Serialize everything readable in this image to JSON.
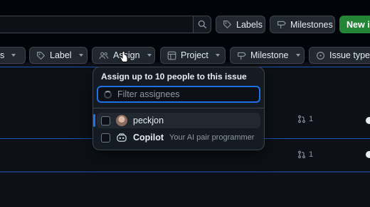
{
  "header": {
    "labels_btn": "Labels",
    "milestones_btn": "Milestones",
    "new_btn": "New is"
  },
  "filters": {
    "partial_left": "s",
    "label": "Label",
    "assignee": "Assign",
    "project": "Project",
    "milestone": "Milestone",
    "issue_type": "Issue type"
  },
  "assign_dropdown": {
    "title": "Assign up to 10 people to this issue",
    "filter_placeholder": "Filter assignees",
    "options": [
      {
        "name": "peckjon",
        "desc": ""
      },
      {
        "name": "Copilot",
        "desc": "Your AI pair programmer"
      }
    ]
  },
  "rows": [
    {
      "pr_count": "1"
    },
    {
      "pr_count": "1"
    }
  ],
  "colors": {
    "background": "#0d1117",
    "accent_blue": "#1f6feb",
    "new_button_green": "#238636",
    "border": "#3d444d"
  }
}
